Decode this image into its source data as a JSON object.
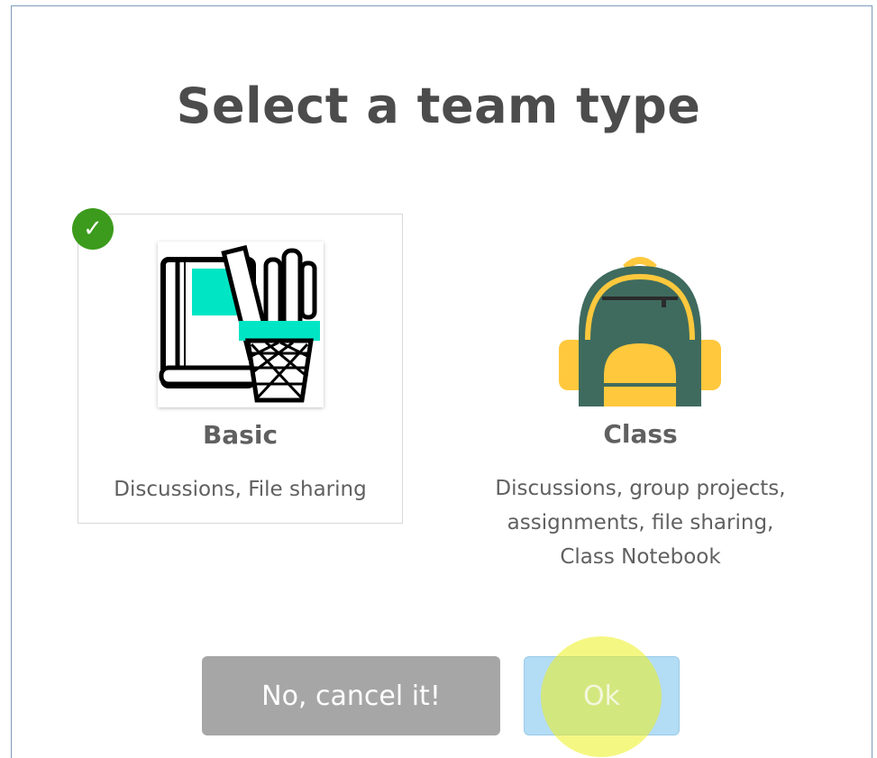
{
  "dialog": {
    "title": "Select a team type"
  },
  "options": [
    {
      "name": "Basic",
      "description": "Discussions, File sharing",
      "icon": "notebook-pencil-cup-icon",
      "selected": true
    },
    {
      "name": "Class",
      "description": "Discussions, group projects, assignments, file sharing, Class Notebook",
      "icon": "backpack-icon",
      "selected": false
    }
  ],
  "buttons": {
    "cancel_label": "No, cancel it!",
    "ok_label": "Ok"
  },
  "colors": {
    "check": "#3c9b1c",
    "cancel_bg": "#a6a6a6",
    "ok_bg": "#b3dcf5",
    "accent_teal": "#00e5c4",
    "backpack_green": "#3f6b5e",
    "backpack_yellow": "#ffc83d",
    "cursor_highlight": "#ecf01e"
  }
}
